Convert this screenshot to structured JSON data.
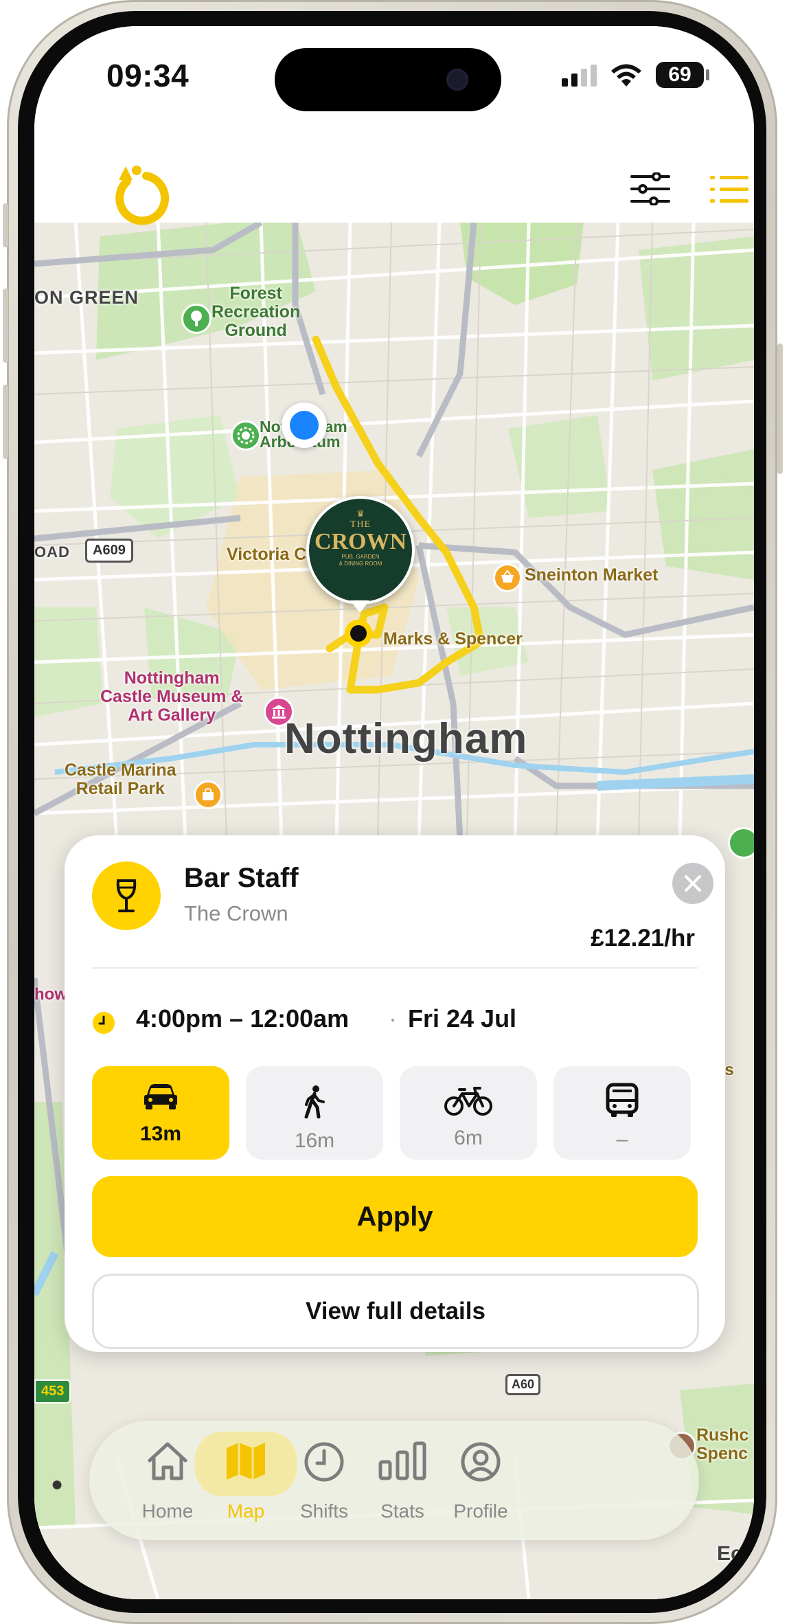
{
  "status_bar": {
    "time": "09:34",
    "battery": "69"
  },
  "map": {
    "labels": {
      "park": "Forest\nRecreation\nGround",
      "district": "ON GREEN",
      "arboretum": "Nottingham\nArboretum",
      "road_a609": "A609",
      "road_oad": "OAD",
      "victoria": "Victoria Centre",
      "sneinton": "Sneinton Market",
      "marks": "Marks & Spencer",
      "castle": "Nottingham\nCastle Museum &\nArt Gallery",
      "city": "Nottingham",
      "marina": "Castle Marina\nRetail Park",
      "road_a60": "A60",
      "road_453": "453",
      "rushcliffe": "Rushc\nSpenc",
      "clip_left": "how",
      "clip_right": "ks",
      "clip_bottom_right": "Ec"
    },
    "venue_logo": {
      "line1": "THE",
      "line2": "CROWN",
      "line3": "PUB, GARDEN\n& DINING ROOM"
    }
  },
  "job_card": {
    "title": "Bar Staff",
    "venue": "The Crown",
    "pay": "£12.21/hr",
    "time_range": "4:00pm – 12:00am",
    "separator": "·",
    "date": "Fri 24 Jul",
    "travel": [
      {
        "mode": "car",
        "label": "13m",
        "selected": true
      },
      {
        "mode": "walk",
        "label": "16m",
        "selected": false
      },
      {
        "mode": "bike",
        "label": "6m",
        "selected": false
      },
      {
        "mode": "bus",
        "label": "–",
        "selected": false
      }
    ],
    "apply_label": "Apply",
    "details_label": "View full details"
  },
  "tab_bar": {
    "tabs": [
      {
        "label": "Home",
        "icon": "home-icon"
      },
      {
        "label": "Map",
        "icon": "map-icon",
        "active": true
      },
      {
        "label": "Shifts",
        "icon": "clock-icon"
      },
      {
        "label": "Stats",
        "icon": "bar-chart-icon"
      },
      {
        "label": "Profile",
        "icon": "person-icon"
      }
    ]
  },
  "colors": {
    "accent": "#ffd200",
    "route": "#f5d11b",
    "user_dot": "#1a84ff"
  }
}
